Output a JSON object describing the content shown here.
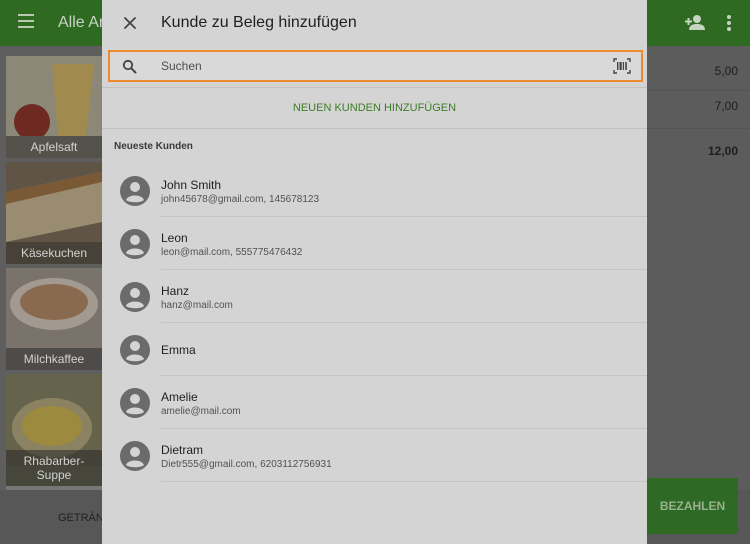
{
  "app": {
    "title": "Alle Ar",
    "bottom_tab": "GETRÄNK",
    "pay_button": "BEZAHLEN",
    "receipt_amounts": [
      "5,00",
      "7,00"
    ],
    "receipt_total": "12,00",
    "tiles": [
      "Apfelsaft",
      "Käsekuchen",
      "Milchkaffee",
      "Rhabarber-\nSuppe"
    ]
  },
  "dialog": {
    "title": "Kunde zu Beleg hinzufügen",
    "search_placeholder": "Suchen",
    "new_customer_label": "NEUEN KUNDEN HINZUFÜGEN",
    "recent_label": "Neueste Kunden",
    "customers": [
      {
        "name": "John Smith",
        "details": "john45678@gmail.com, 145678123"
      },
      {
        "name": "Leon",
        "details": "leon@mail.com, 555775476432"
      },
      {
        "name": "Hanz",
        "details": "hanz@mail.com"
      },
      {
        "name": "Emma",
        "details": ""
      },
      {
        "name": "Amelie",
        "details": "amelie@mail.com"
      },
      {
        "name": "Dietram",
        "details": "Dietr555@gmail.com, 6203112756931"
      }
    ]
  },
  "colors": {
    "accent_green": "#3c7d26",
    "search_border": "#ee8a2f"
  },
  "icons": {
    "close": "close-icon",
    "search": "search-icon",
    "scan": "barcode-scan-icon",
    "avatar": "account-circle-icon",
    "menu": "menu-icon",
    "add_person": "person-add-icon",
    "more": "more-vert-icon"
  }
}
